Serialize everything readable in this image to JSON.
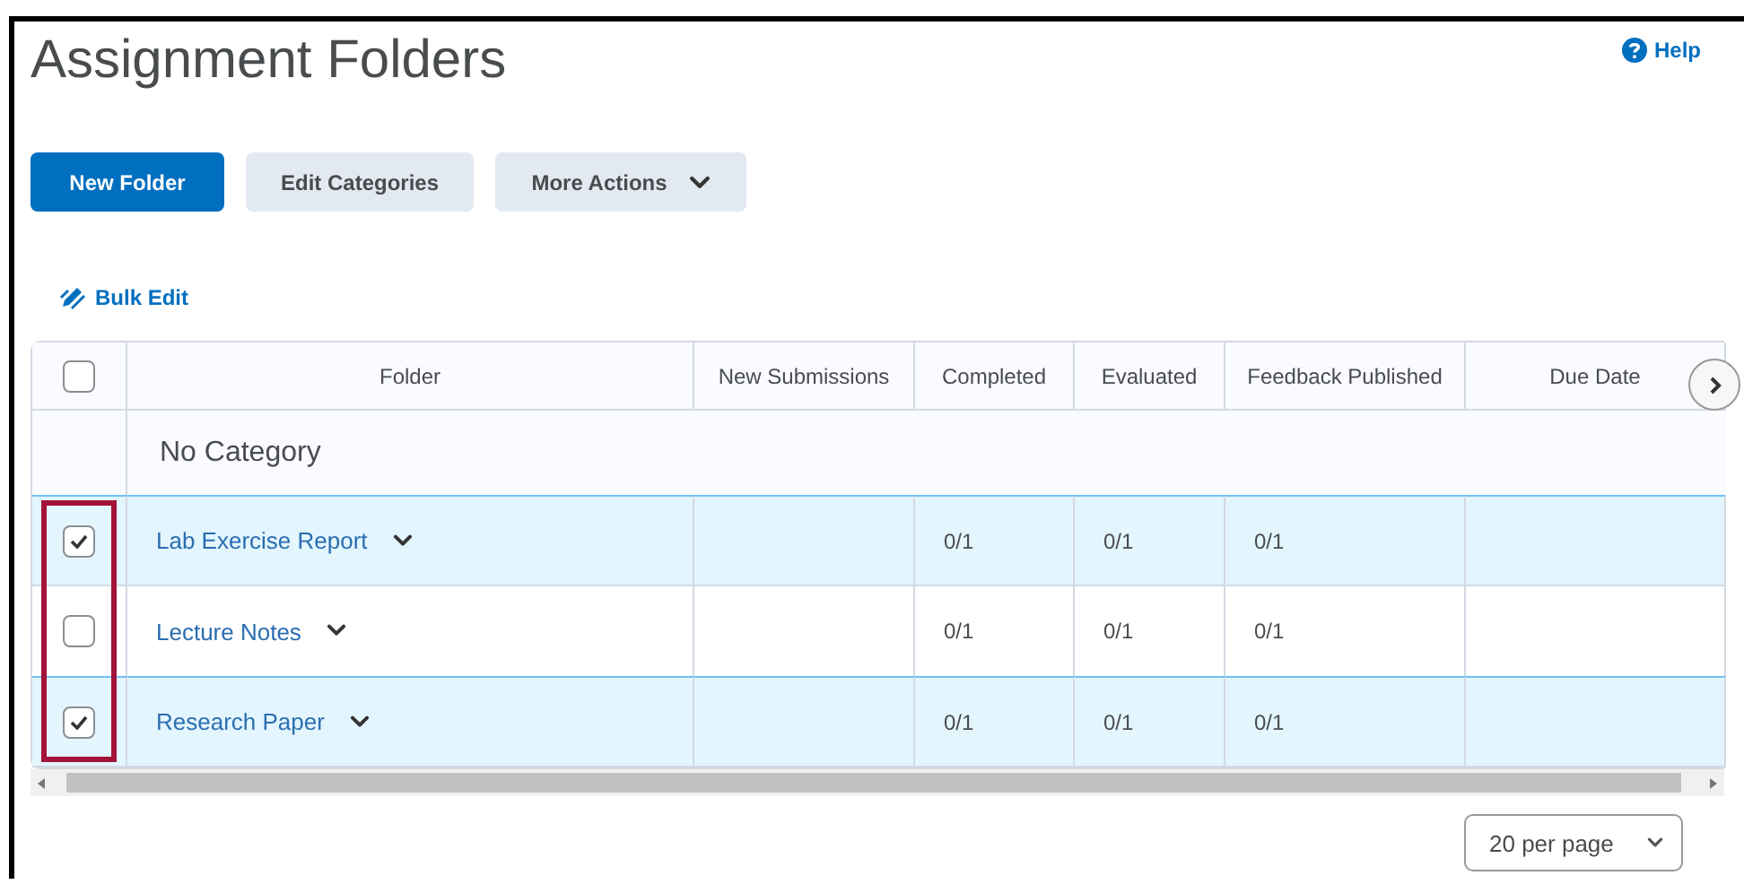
{
  "page": {
    "title": "Assignment Folders",
    "help": "Help"
  },
  "buttons": [
    {
      "label": "New Folder",
      "kind": "primary"
    },
    {
      "label": "Edit Categories",
      "kind": "secondary"
    },
    {
      "label": "More Actions",
      "kind": "menu"
    }
  ],
  "bulk_edit": "Bulk Edit",
  "table": {
    "select_all": {
      "checked": false
    },
    "columns": [
      "Folder",
      "New Submissions",
      "Completed",
      "Evaluated",
      "Feedback Published",
      "Due Date"
    ],
    "category": "No Category",
    "rows": [
      {
        "folder": "Lab Exercise Report",
        "selected": true,
        "completed": "0/1",
        "evaluated": "0/1",
        "feedback_published": "0/1"
      },
      {
        "folder": "Lecture Notes",
        "selected": false,
        "completed": "0/1",
        "evaluated": "0/1",
        "feedback_published": "0/1"
      },
      {
        "folder": "Research Paper",
        "selected": true,
        "completed": "0/1",
        "evaluated": "0/1",
        "feedback_published": "0/1"
      }
    ]
  },
  "pagination": {
    "per_page": "20 per page"
  }
}
